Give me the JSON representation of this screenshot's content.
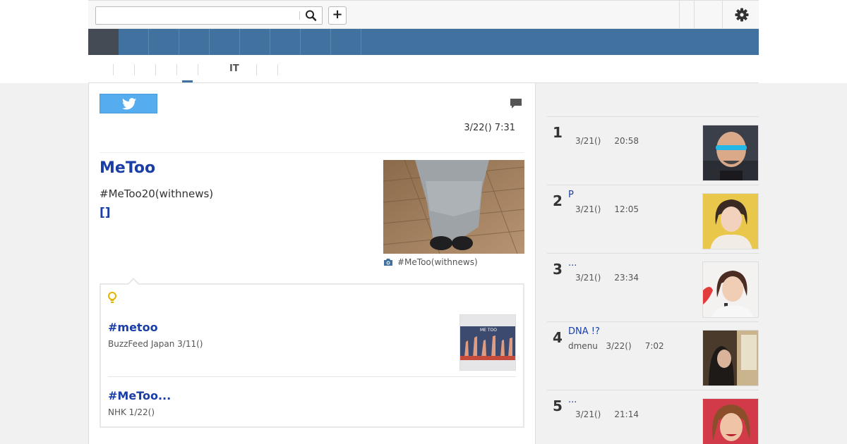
{
  "search": {
    "value": "",
    "placeholder": ""
  },
  "toolbar": {
    "add_label": "+"
  },
  "subnav": {
    "visible_label": "IT"
  },
  "article": {
    "date": "3/22() 7:31",
    "title": "MeToo",
    "summary": "#MeToo20(withnews)",
    "more_label": "[]",
    "photo_caption": "#MeToo(withnews)"
  },
  "related": [
    {
      "title": "#metoo",
      "source": "BuzzFeed Japan 3/11()",
      "thumb_text": "ME TOO"
    },
    {
      "title": "#MeToo...",
      "source": "NHK  1/22()"
    }
  ],
  "ranking": [
    {
      "num": "1",
      "title": "",
      "meta": "3/21()     20:58",
      "source_first": false
    },
    {
      "num": "2",
      "title": "P",
      "meta": "3/21()     12:05",
      "source_first": false
    },
    {
      "num": "3",
      "title": "...",
      "meta": "3/21()     23:34",
      "source_first": false
    },
    {
      "num": "4",
      "title": "DNA !?",
      "meta": "dmenu   3/22()     7:02",
      "source_first": true
    },
    {
      "num": "5",
      "title": " ...",
      "meta": "3/21()     21:14",
      "source_first": false
    }
  ],
  "colors": {
    "brand_blue": "#41719e",
    "link": "#1a3ea6",
    "twitter": "#55acee"
  }
}
